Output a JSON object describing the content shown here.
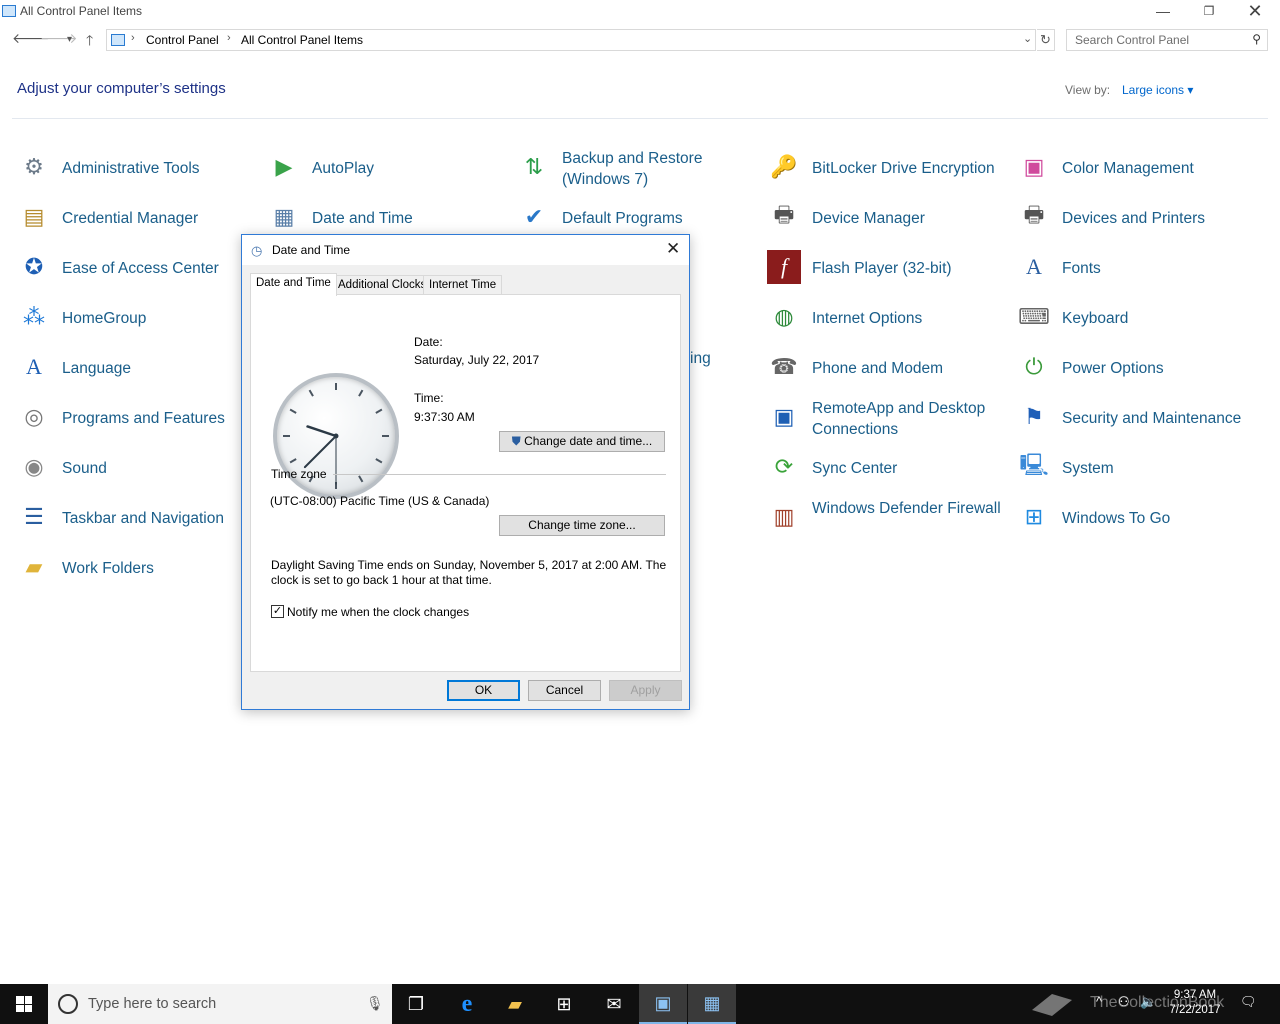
{
  "window": {
    "title": "All Control Panel Items",
    "minimize_glyph": "—",
    "maximize_glyph": "❐",
    "close_glyph": "✕"
  },
  "address_bar": {
    "breadcrumbs": [
      "Control Panel",
      "All Control Panel Items"
    ],
    "separator": "›",
    "search_placeholder": "Search Control Panel"
  },
  "header": {
    "title": "Adjust your computer’s settings",
    "view_by_label": "View by:",
    "view_by_value": "Large icons ▾"
  },
  "items": [
    {
      "label": "Administrative Tools",
      "icon": "admin-tools-icon"
    },
    {
      "label": "AutoPlay",
      "icon": "autoplay-icon"
    },
    {
      "label": "Backup and Restore (Windows 7)",
      "icon": "backup-icon"
    },
    {
      "label": "BitLocker Drive Encryption",
      "icon": "bitlocker-icon"
    },
    {
      "label": "Color Management",
      "icon": "color-management-icon"
    },
    {
      "label": "Credential Manager",
      "icon": "credential-icon"
    },
    {
      "label": "Date and Time",
      "icon": "date-time-icon"
    },
    {
      "label": "Default Programs",
      "icon": "default-programs-icon"
    },
    {
      "label": "Device Manager",
      "icon": "device-manager-icon"
    },
    {
      "label": "Devices and Printers",
      "icon": "printer-icon"
    },
    {
      "label": "Ease of Access Center",
      "icon": "ease-of-access-icon"
    },
    {
      "label": "Flash Player (32-bit)",
      "icon": "flash-icon"
    },
    {
      "label": "Fonts",
      "icon": "fonts-icon"
    },
    {
      "label": "HomeGroup",
      "icon": "homegroup-icon"
    },
    {
      "label": "Internet Options",
      "icon": "internet-options-icon"
    },
    {
      "label": "Keyboard",
      "icon": "keyboard-icon"
    },
    {
      "label": "Language",
      "icon": "language-icon"
    },
    {
      "label": "Phone and Modem",
      "icon": "phone-icon"
    },
    {
      "label": "Power Options",
      "icon": "power-icon"
    },
    {
      "label": "Programs and Features",
      "icon": "programs-icon"
    },
    {
      "label": "RemoteApp and Desktop Connections",
      "icon": "remoteapp-icon"
    },
    {
      "label": "Security and Maintenance",
      "icon": "flag-icon"
    },
    {
      "label": "Sound",
      "icon": "sound-icon"
    },
    {
      "label": "Sync Center",
      "icon": "sync-icon"
    },
    {
      "label": "System",
      "icon": "system-icon"
    },
    {
      "label": "Taskbar and Navigation",
      "icon": "taskbar-icon"
    },
    {
      "label": "Windows Defender Firewall",
      "icon": "firewall-icon"
    },
    {
      "label": "Windows To Go",
      "icon": "windows-to-go-icon"
    },
    {
      "label": "Work Folders",
      "icon": "work-folders-icon"
    }
  ],
  "partial_item_text": "ing",
  "dialog": {
    "title": "Date and Time",
    "tabs": [
      "Date and Time",
      "Additional Clocks",
      "Internet Time"
    ],
    "date_label": "Date:",
    "date_value": "Saturday, July 22, 2017",
    "time_label": "Time:",
    "time_value": "9:37:30 AM",
    "change_date_button": "Change date and time...",
    "time_zone_heading": "Time zone",
    "time_zone_value": "(UTC-08:00) Pacific Time (US & Canada)",
    "change_zone_button": "Change time zone...",
    "dst_line1": "Daylight Saving Time ends on Sunday, November 5, 2017 at 2:00 AM. The",
    "dst_line2": "clock is set to go back 1 hour at that time.",
    "notify_label": "Notify me when the clock changes",
    "notify_checked": true,
    "ok": "OK",
    "cancel": "Cancel",
    "apply": "Apply",
    "clock_hours": 9,
    "clock_minutes": 37,
    "clock_seconds": 30
  },
  "taskbar": {
    "search_placeholder": "Type here to search",
    "time": "9:37 AM",
    "date": "7/22/2017",
    "watermark": "TheCollectionBook"
  }
}
